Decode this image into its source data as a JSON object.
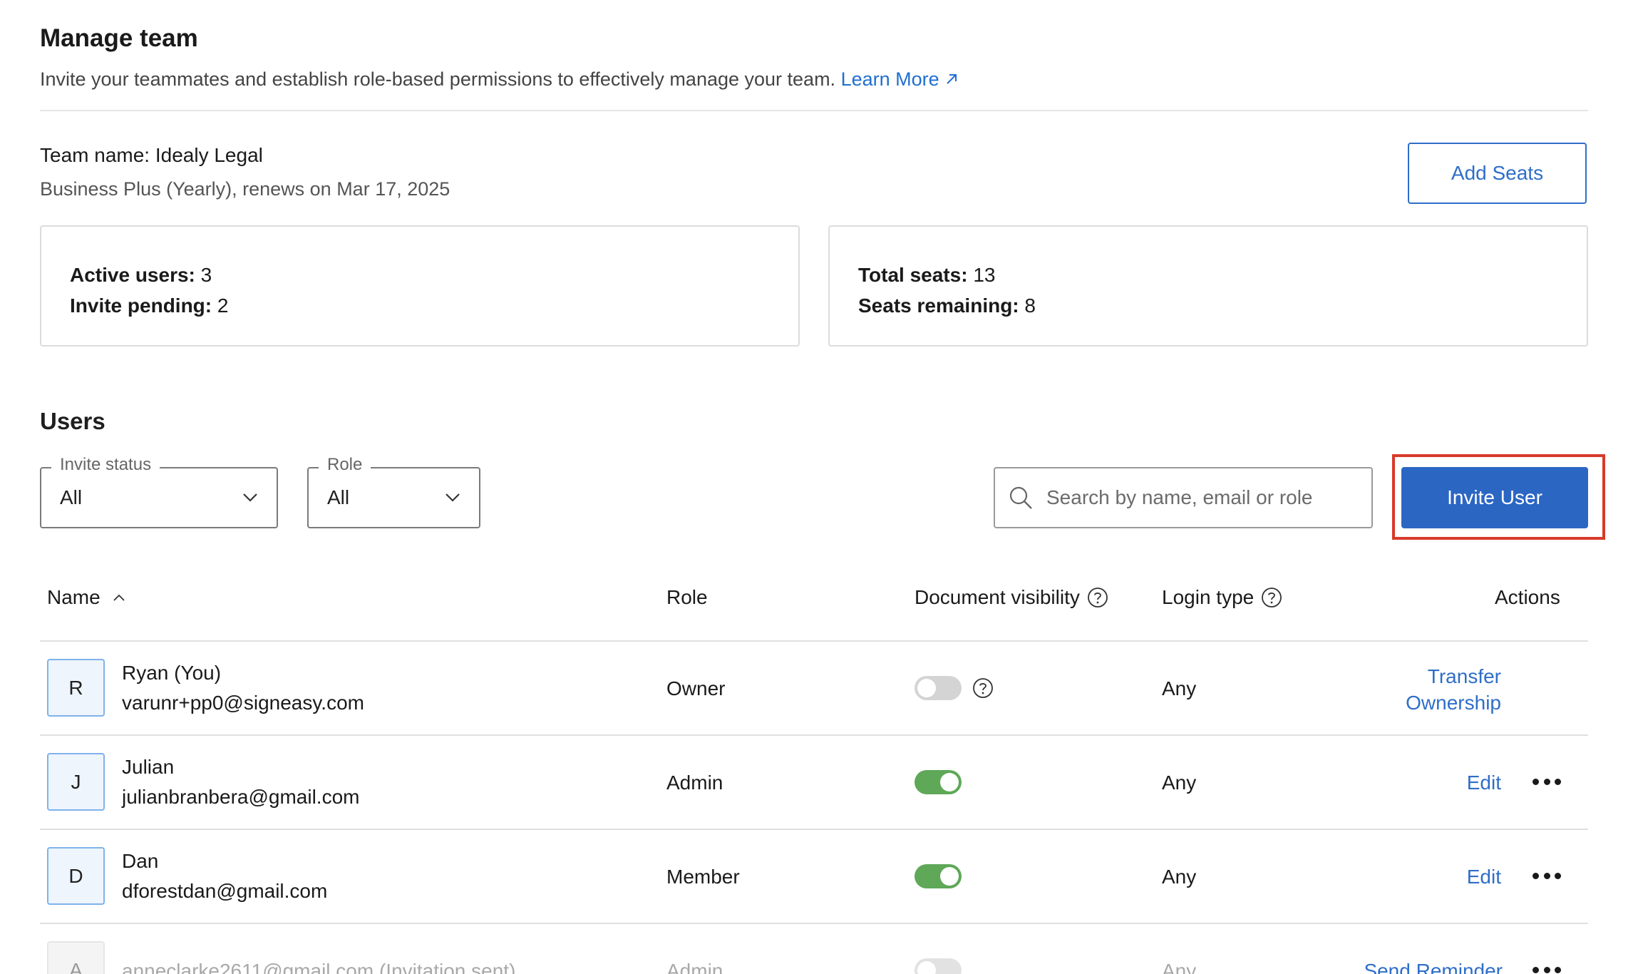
{
  "header": {
    "title": "Manage team",
    "subtitle": "Invite your teammates and establish role-based permissions to effectively manage your team.",
    "learn_more": "Learn More"
  },
  "team": {
    "name_label": "Team name:",
    "name": "Idealy Legal",
    "plan": "Business Plus (Yearly), renews on Mar 17, 2025",
    "add_seats": "Add Seats"
  },
  "stats": {
    "active_users_label": "Active users:",
    "active_users": "3",
    "invite_pending_label": "Invite pending:",
    "invite_pending": "2",
    "total_seats_label": "Total seats:",
    "total_seats": "13",
    "seats_remaining_label": "Seats remaining:",
    "seats_remaining": "8"
  },
  "users": {
    "heading": "Users",
    "filters": {
      "invite_status_label": "Invite status",
      "invite_status_value": "All",
      "role_label": "Role",
      "role_value": "All"
    },
    "search_placeholder": "Search by name, email or role",
    "invite_button": "Invite User",
    "columns": {
      "name": "Name",
      "role": "Role",
      "doc_visibility": "Document visibility",
      "login_type": "Login type",
      "actions": "Actions"
    },
    "rows": [
      {
        "initial": "R",
        "name": "Ryan (You)",
        "email": "varunr+pp0@signeasy.com",
        "role": "Owner",
        "visibility_on": false,
        "login": "Any",
        "action_line1": "Transfer",
        "action_line2": "Ownership"
      },
      {
        "initial": "J",
        "name": "Julian",
        "email": "julianbranbera@gmail.com",
        "role": "Admin",
        "visibility_on": true,
        "login": "Any",
        "action": "Edit"
      },
      {
        "initial": "D",
        "name": "Dan",
        "email": "dforestdan@gmail.com",
        "role": "Member",
        "visibility_on": true,
        "login": "Any",
        "action": "Edit"
      },
      {
        "initial": "A",
        "email": "anneclarke2611@gmail.com (Invitation sent)",
        "role": "Admin",
        "visibility_on": false,
        "login": "Any",
        "action": "Send Reminder"
      }
    ]
  },
  "colors": {
    "accent": "#2b66c3",
    "link": "#1f6fd1",
    "toggle_on": "#5ea858",
    "highlight": "#d83a2a"
  }
}
